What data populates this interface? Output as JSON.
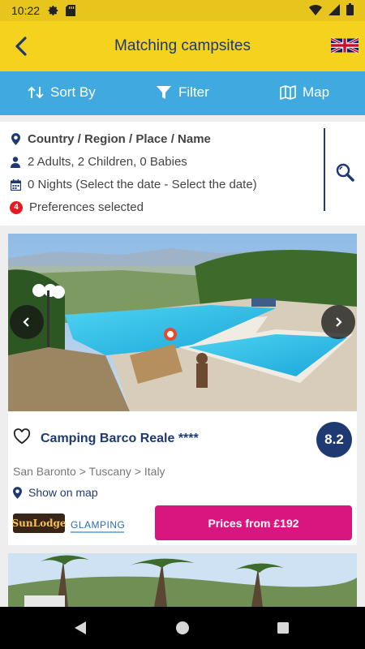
{
  "status_bar": {
    "time": "10:22"
  },
  "app_bar": {
    "title": "Matching campsites"
  },
  "toolbar": {
    "sort_label": "Sort By",
    "filter_label": "Filter",
    "map_label": "Map"
  },
  "search": {
    "destination": "Country / Region / Place / Name",
    "guests": "2 Adults, 2 Children, 0 Babies",
    "dates": "0 Nights (Select the date - Select the date)",
    "preferences_count": "4",
    "preferences_label": "Preferences selected"
  },
  "listing": {
    "name": "Camping Barco Reale ****",
    "score": "8.2",
    "location": "San Baronto > Tuscany > Italy",
    "map_link": "Show on map",
    "sunlodge_logo": "SunLodge",
    "glamping_label": "GLAMPING",
    "price_button": "Prices from £192"
  },
  "colors": {
    "brand_yellow": "#f4d21e",
    "toolbar_blue": "#3fa9e0",
    "navy": "#1f3a72",
    "price_pink": "#d9167f"
  },
  "icons": [
    "settings-icon",
    "sd-card-icon",
    "wifi-icon",
    "signal-icon",
    "battery-icon",
    "back-icon",
    "uk-flag-icon",
    "sort-icon",
    "filter-icon",
    "map-icon",
    "location-pin-icon",
    "person-icon",
    "calendar-icon",
    "search-icon",
    "heart-icon",
    "chevron-left-icon",
    "chevron-right-icon"
  ]
}
